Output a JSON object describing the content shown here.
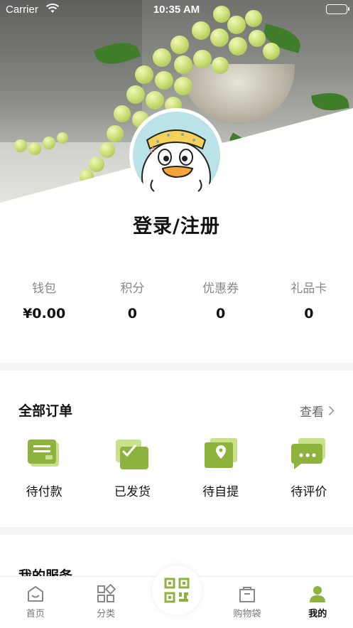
{
  "status_bar": {
    "carrier": "Carrier",
    "time": "10:35 AM",
    "battery_level": 1.0
  },
  "profile": {
    "login_label": "登录/注册"
  },
  "stats": [
    {
      "label": "钱包",
      "value": "¥0.00"
    },
    {
      "label": "积分",
      "value": "0"
    },
    {
      "label": "优惠券",
      "value": "0"
    },
    {
      "label": "礼品卡",
      "value": "0"
    }
  ],
  "orders": {
    "title": "全部订单",
    "more_label": "查看",
    "items": [
      {
        "label": "待付款",
        "icon": "wallet-card-icon"
      },
      {
        "label": "已发货",
        "icon": "check-box-icon"
      },
      {
        "label": "待自提",
        "icon": "map-pin-icon"
      },
      {
        "label": "待评价",
        "icon": "chat-bubble-icon"
      }
    ]
  },
  "services": {
    "title": "我的服务"
  },
  "tabbar": {
    "items": [
      {
        "label": "首页",
        "icon": "home-icon"
      },
      {
        "label": "分类",
        "icon": "category-grid-icon"
      },
      {
        "label": "",
        "icon": "qr-scan-icon"
      },
      {
        "label": "购物袋",
        "icon": "shopping-bag-icon"
      },
      {
        "label": "我的",
        "icon": "user-icon",
        "active": true
      }
    ]
  },
  "colors": {
    "accent": "#8db33e",
    "accent_light": "#c8e08a",
    "text": "#111111",
    "muted": "#888888"
  }
}
